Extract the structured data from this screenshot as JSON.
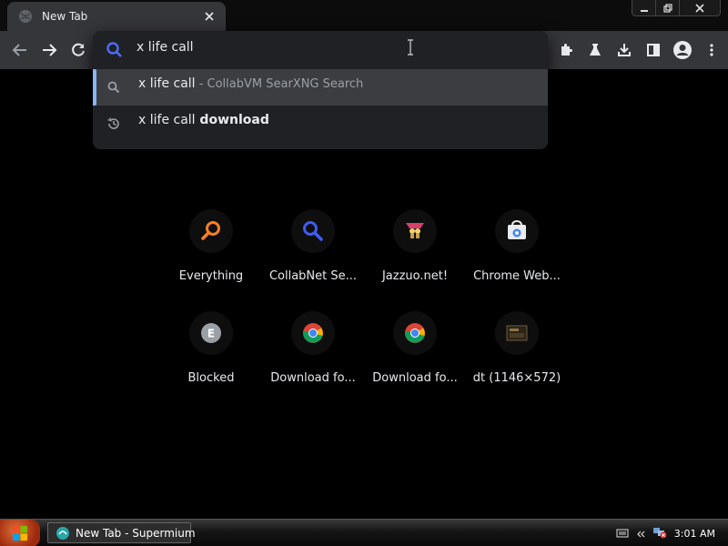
{
  "tab": {
    "title": "New Tab"
  },
  "omnibox": {
    "input_value": "x life call",
    "suggestions": [
      {
        "text": "x life call",
        "suffix": " - CollabVM SearXNG Search",
        "icon": "search-icon"
      },
      {
        "text": "x life call",
        "bold": " download",
        "icon": "history-icon"
      }
    ]
  },
  "tiles": [
    {
      "label": "Everything",
      "icon": "magnifier-orange-icon"
    },
    {
      "label": "CollabNet Se...",
      "icon": "magnifier-blue-icon"
    },
    {
      "label": "Jazzuo.net!",
      "icon": "jazzuo-icon"
    },
    {
      "label": "Chrome Web...",
      "icon": "chrome-web-store-icon"
    },
    {
      "label": "Blocked",
      "icon": "letter-e-icon"
    },
    {
      "label": "Download fo...",
      "icon": "chrome-icon"
    },
    {
      "label": "Download fo...",
      "icon": "chrome-icon"
    },
    {
      "label": "dt (1146×572)",
      "icon": "thumbnail-icon"
    }
  ],
  "taskbar": {
    "task_label": "New Tab - Supermium",
    "clock": "3:01 AM"
  },
  "colors": {
    "toolbar": "#35363a",
    "omnibox_bg": "#202124",
    "accent_blue": "#8ab4f8",
    "search_icon_blue": "#4c6ef5"
  }
}
